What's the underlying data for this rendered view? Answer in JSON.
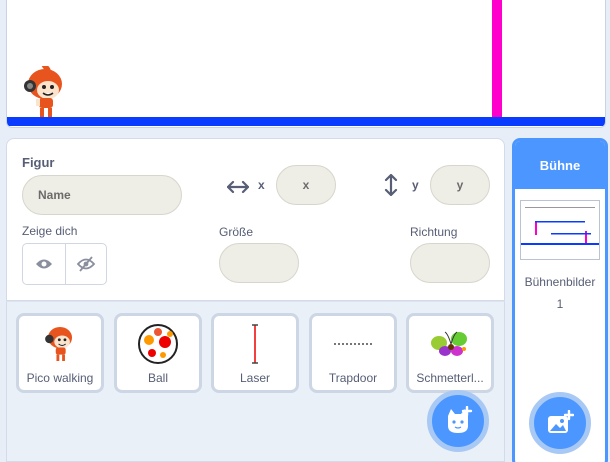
{
  "sprite_info": {
    "title": "Figur",
    "name_placeholder": "Name",
    "x_label": "x",
    "x_placeholder": "x",
    "y_label": "y",
    "y_placeholder": "y",
    "show_label": "Zeige dich",
    "size_label": "Größe",
    "direction_label": "Richtung"
  },
  "sprites": [
    {
      "name": "Pico walking",
      "icon": "pico-icon"
    },
    {
      "name": "Ball",
      "icon": "ball-icon"
    },
    {
      "name": "Laser",
      "icon": "laser-icon"
    },
    {
      "name": "Trapdoor",
      "icon": "trapdoor-icon"
    },
    {
      "name": "Schmetterl...",
      "icon": "butterfly-icon"
    }
  ],
  "stage_pane": {
    "title": "Bühne",
    "backdrops_label": "Bühnenbilder",
    "backdrops_count": "1"
  },
  "colors": {
    "accent": "#4c97ff",
    "floor": "#0a3cff",
    "pole": "#ff00cc"
  }
}
